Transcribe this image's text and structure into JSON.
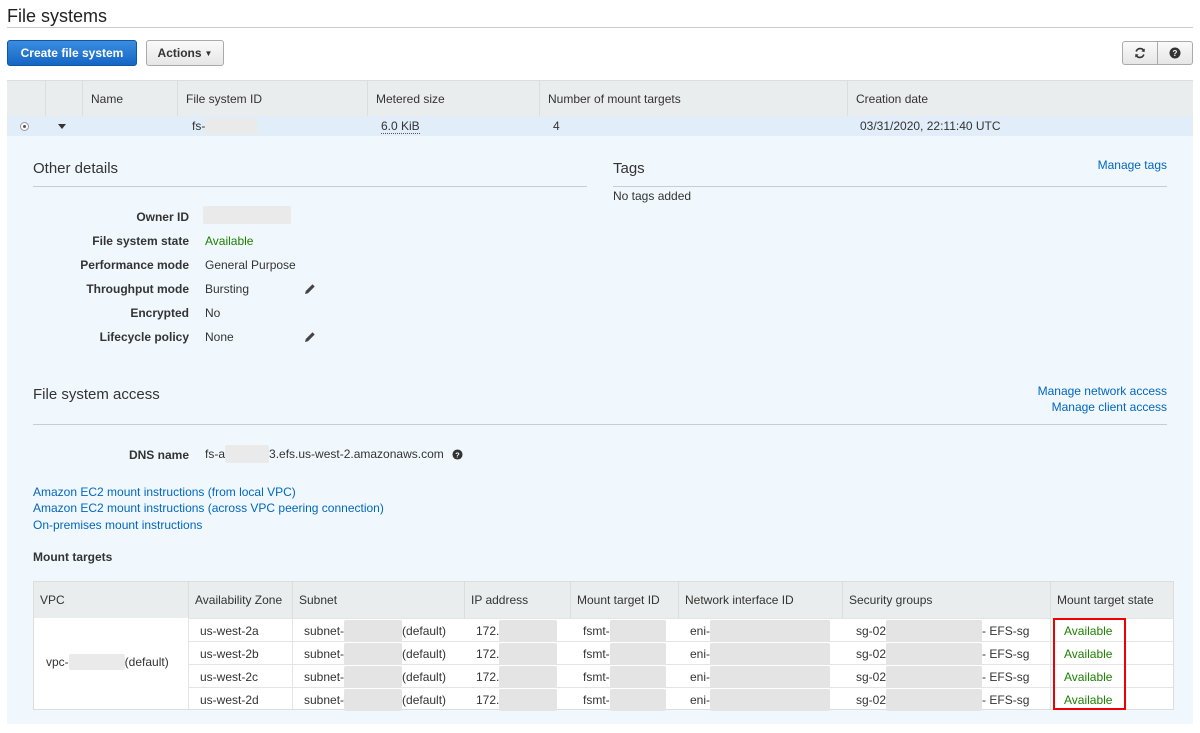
{
  "page": {
    "title": "File systems"
  },
  "toolbar": {
    "create_label": "Create file system",
    "actions_label": "Actions",
    "refresh_icon": "refresh-icon",
    "help_icon": "help-icon"
  },
  "fs_table": {
    "columns": [
      "Name",
      "File system ID",
      "Metered size",
      "Number of mount targets",
      "Creation date"
    ],
    "row": {
      "name": "",
      "id_prefix": "fs-",
      "metered_size": "6.0 KiB",
      "mount_targets": "4",
      "creation_date": "03/31/2020, 22:11:40 UTC"
    }
  },
  "other_details": {
    "title": "Other details",
    "rows": [
      {
        "label": "Owner ID",
        "value": ""
      },
      {
        "label": "File system state",
        "value": "Available"
      },
      {
        "label": "Performance mode",
        "value": "General Purpose"
      },
      {
        "label": "Throughput mode",
        "value": "Bursting"
      },
      {
        "label": "Encrypted",
        "value": "No"
      },
      {
        "label": "Lifecycle policy",
        "value": "None"
      }
    ]
  },
  "tags": {
    "title": "Tags",
    "manage_label": "Manage tags",
    "empty_text": "No tags added"
  },
  "access": {
    "title": "File system access",
    "manage_network": "Manage network access",
    "manage_client": "Manage client access",
    "dns_label": "DNS name",
    "dns_prefix": "fs-a",
    "dns_suffix": "3.efs.us-west-2.amazonaws.com",
    "links": [
      "Amazon EC2 mount instructions (from local VPC)",
      "Amazon EC2 mount instructions (across VPC peering connection)",
      "On-premises mount instructions"
    ]
  },
  "mount_targets": {
    "title": "Mount targets",
    "columns": [
      "VPC",
      "Availability Zone",
      "Subnet",
      "IP address",
      "Mount target ID",
      "Network interface ID",
      "Security groups",
      "Mount target state"
    ],
    "vpc_prefix": "vpc-",
    "vpc_suffix": "(default)",
    "rows": [
      {
        "az": "us-west-2a",
        "subnet": "subnet-",
        "subnet_suffix": "(default)",
        "ip": "172.",
        "mt_id": "fsmt-",
        "eni": "eni-",
        "sg": "sg-02",
        "sg_suffix": "- EFS-sg",
        "state": "Available"
      },
      {
        "az": "us-west-2b",
        "subnet": "subnet-",
        "subnet_suffix": "(default)",
        "ip": "172.",
        "mt_id": "fsmt-",
        "eni": "eni-",
        "sg": "sg-02",
        "sg_suffix": "- EFS-sg",
        "state": "Available"
      },
      {
        "az": "us-west-2c",
        "subnet": "subnet-",
        "subnet_suffix": "(default)",
        "ip": "172.",
        "mt_id": "fsmt-",
        "eni": "eni-",
        "sg": "sg-02",
        "sg_suffix": "- EFS-sg",
        "state": "Available"
      },
      {
        "az": "us-west-2d",
        "subnet": "subnet-",
        "subnet_suffix": "(default)",
        "ip": "172.",
        "mt_id": "fsmt-",
        "eni": "eni-",
        "sg": "sg-02",
        "sg_suffix": "- EFS-sg",
        "state": "Available"
      }
    ]
  },
  "colors": {
    "accent": "#0066c0",
    "status_ok": "#1d8102",
    "primary_button": "#1566c4",
    "highlight": "#e00000"
  }
}
